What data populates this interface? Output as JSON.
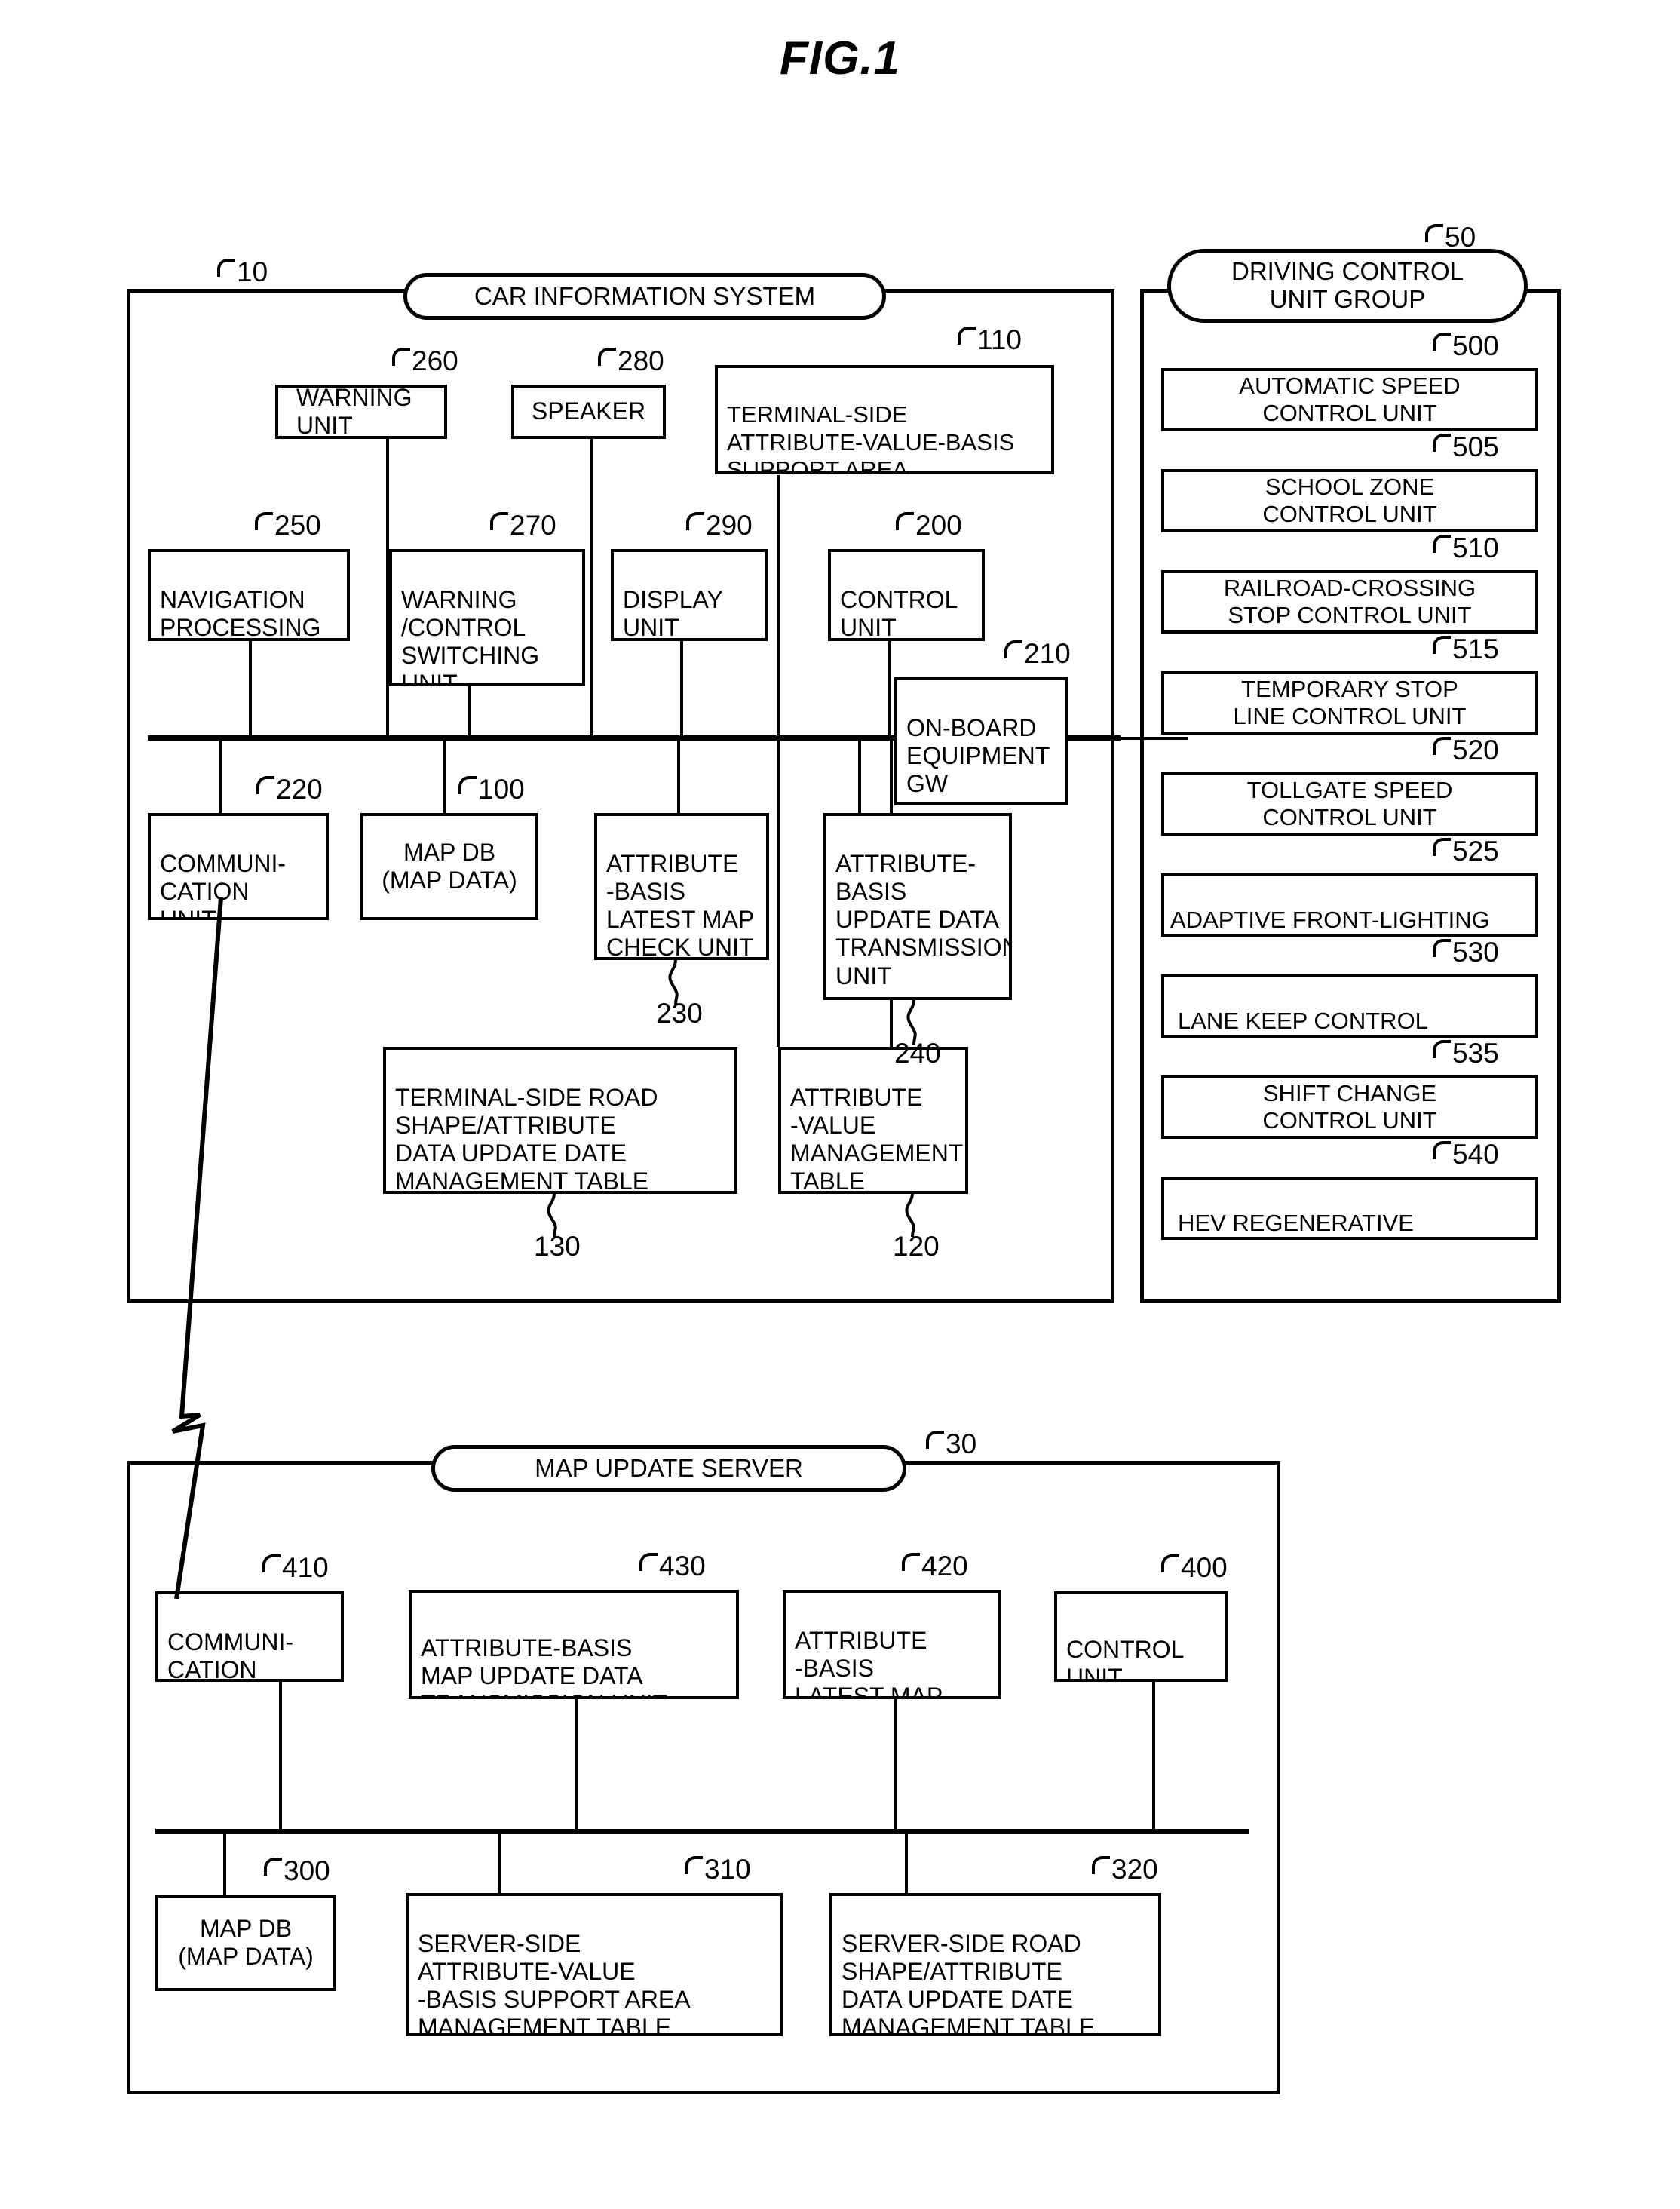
{
  "figure": {
    "title": "FIG.1"
  },
  "car_information_system": {
    "ref": "10",
    "title": "CAR INFORMATION SYSTEM",
    "components": [
      {
        "ref": "260",
        "label": "WARNING\nUNIT"
      },
      {
        "ref": "280",
        "label": "SPEAKER"
      },
      {
        "ref": "110",
        "label": "TERMINAL-SIDE\nATTRIBUTE-VALUE-BASIS\nSUPPORT AREA\nMANAGEMENT TABLE"
      },
      {
        "ref": "250",
        "label": "NAVIGATION\nPROCESSING\nUNIT"
      },
      {
        "ref": "270",
        "label": "WARNING\n/CONTROL\nSWITCHING\nUNIT"
      },
      {
        "ref": "290",
        "label": "DISPLAY\nUNIT"
      },
      {
        "ref": "200",
        "label": "CONTROL\nUNIT"
      },
      {
        "ref": "210",
        "label": "ON-BOARD\nEQUIPMENT\nGW"
      },
      {
        "ref": "220",
        "label": "COMMUNI-\nCATION\nUNIT"
      },
      {
        "ref": "100",
        "label": "MAP DB\n(MAP DATA)"
      },
      {
        "ref": "230",
        "label": "ATTRIBUTE\n-BASIS\nLATEST MAP\nCHECK UNIT"
      },
      {
        "ref": "240",
        "label": "ATTRIBUTE-\nBASIS\nUPDATE DATA\nTRANSMISSION\nUNIT"
      },
      {
        "ref": "130",
        "label": "TERMINAL-SIDE ROAD\nSHAPE/ATTRIBUTE\nDATA UPDATE DATE\nMANAGEMENT TABLE"
      },
      {
        "ref": "120",
        "label": "ATTRIBUTE\n-VALUE\nMANAGEMENT\nTABLE"
      }
    ]
  },
  "driving_control_unit_group": {
    "ref": "50",
    "title": "DRIVING CONTROL\nUNIT GROUP",
    "units": [
      {
        "ref": "500",
        "label": "AUTOMATIC SPEED\nCONTROL UNIT"
      },
      {
        "ref": "505",
        "label": "SCHOOL ZONE\nCONTROL UNIT"
      },
      {
        "ref": "510",
        "label": "RAILROAD-CROSSING\nSTOP CONTROL UNIT"
      },
      {
        "ref": "515",
        "label": "TEMPORARY STOP\nLINE CONTROL UNIT"
      },
      {
        "ref": "520",
        "label": "TOLLGATE SPEED\nCONTROL UNIT"
      },
      {
        "ref": "525",
        "label": "ADAPTIVE FRONT-LIGHTING\nCONTROL UNIT"
      },
      {
        "ref": "530",
        "label": "LANE KEEP CONTROL\nUNIT"
      },
      {
        "ref": "535",
        "label": "SHIFT CHANGE\nCONTROL UNIT"
      },
      {
        "ref": "540",
        "label": "HEV REGENERATIVE\nBRAKE CONTROL UNIT"
      }
    ]
  },
  "map_update_server": {
    "ref": "30",
    "title": "MAP UPDATE SERVER",
    "components": [
      {
        "ref": "410",
        "label": "COMMUNI-\nCATION\nUNIT"
      },
      {
        "ref": "430",
        "label": "ATTRIBUTE-BASIS\nMAP UPDATE DATA\nTRANSMISSION UNIT"
      },
      {
        "ref": "420",
        "label": "ATTRIBUTE\n-BASIS\nLATEST MAP\nCHECK UNIT"
      },
      {
        "ref": "400",
        "label": "CONTROL\nUNIT"
      },
      {
        "ref": "300",
        "label": "MAP DB\n(MAP DATA)"
      },
      {
        "ref": "310",
        "label": "SERVER-SIDE\nATTRIBUTE-VALUE\n-BASIS SUPPORT AREA\nMANAGEMENT TABLE"
      },
      {
        "ref": "320",
        "label": "SERVER-SIDE ROAD\nSHAPE/ATTRIBUTE\nDATA UPDATE DATE\nMANAGEMENT TABLE"
      }
    ]
  },
  "link": {
    "name": "wireless-link-bolt"
  }
}
